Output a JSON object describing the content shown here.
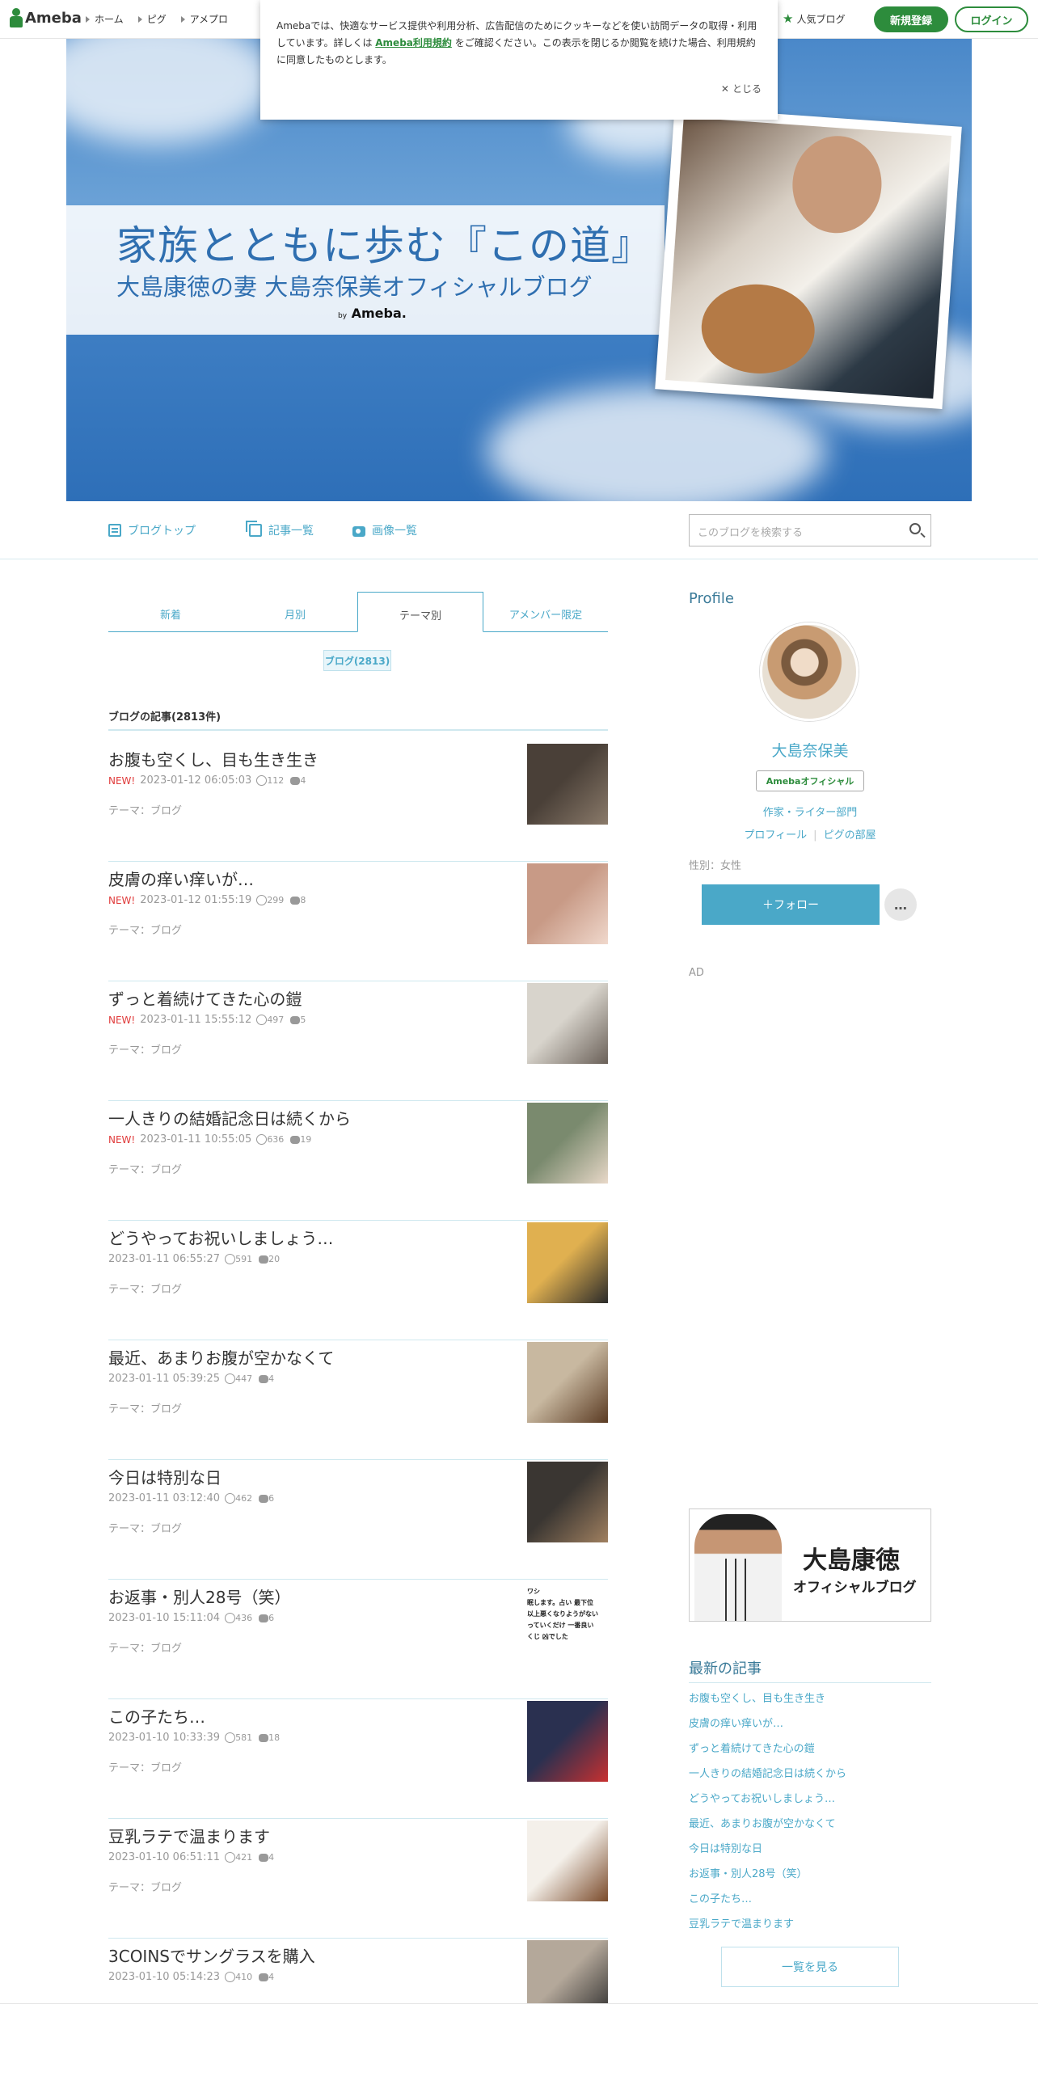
{
  "topbar": {
    "logo": "Ameba",
    "nav": [
      "ホーム",
      "ピグ",
      "アメプロ"
    ],
    "popular": "人気ブログ",
    "signup": "新規登録",
    "login": "ログイン"
  },
  "cookie": {
    "text_before": "Amebaでは、快適なサービス提供や利用分析、広告配信のためにクッキーなどを使い訪問データの取得・利用しています。詳しくは ",
    "link": "Ameba利用規約",
    "text_after": " をご確認ください。この表示を閉じるか閲覧を続けた場合、利用規約に同意したものとします。",
    "close": "とじる"
  },
  "banner": {
    "title": "家族とともに歩む『この道』",
    "subtitle": "大島康徳の妻 大島奈保美オフィシャルブログ",
    "by": "by",
    "brand": "Ameba."
  },
  "blognav": {
    "top": "ブログトップ",
    "list": "記事一覧",
    "images": "画像一覧",
    "search_placeholder": "このブログを検索する"
  },
  "tabs": [
    "新着",
    "月別",
    "テーマ別",
    "アメンバー限定"
  ],
  "theme_tag": "ブログ(2813)",
  "list_heading": "ブログの記事(2813件)",
  "posts": [
    {
      "title": "お腹も空くし、目も生き生き",
      "new": "NEW!",
      "date": "2023-01-12 06:05:03",
      "likes": "112",
      "comments": "4",
      "theme": "テーマ：ブログ"
    },
    {
      "title": "皮膚の痒い痒いが…",
      "new": "NEW!",
      "date": "2023-01-12 01:55:19",
      "likes": "299",
      "comments": "8",
      "theme": "テーマ：ブログ"
    },
    {
      "title": "ずっと着続けてきた心の鎧",
      "new": "NEW!",
      "date": "2023-01-11 15:55:12",
      "likes": "497",
      "comments": "5",
      "theme": "テーマ：ブログ"
    },
    {
      "title": "一人きりの結婚記念日は続くから",
      "new": "NEW!",
      "date": "2023-01-11 10:55:05",
      "likes": "636",
      "comments": "19",
      "theme": "テーマ：ブログ"
    },
    {
      "title": "どうやってお祝いしましょう…",
      "new": "",
      "date": "2023-01-11 06:55:27",
      "likes": "591",
      "comments": "20",
      "theme": "テーマ：ブログ"
    },
    {
      "title": "最近、あまりお腹が空かなくて",
      "new": "",
      "date": "2023-01-11 05:39:25",
      "likes": "447",
      "comments": "4",
      "theme": "テーマ：ブログ"
    },
    {
      "title": "今日は特別な日",
      "new": "",
      "date": "2023-01-11 03:12:40",
      "likes": "462",
      "comments": "6",
      "theme": "テーマ：ブログ"
    },
    {
      "title": "お返事・別人28号（笑）",
      "new": "",
      "date": "2023-01-10 15:11:04",
      "likes": "436",
      "comments": "6",
      "theme": "テーマ：ブログ"
    },
    {
      "title": "この子たち…",
      "new": "",
      "date": "2023-01-10 10:33:39",
      "likes": "581",
      "comments": "18",
      "theme": "テーマ：ブログ"
    },
    {
      "title": "豆乳ラテで温まります",
      "new": "",
      "date": "2023-01-10 06:51:11",
      "likes": "421",
      "comments": "4",
      "theme": "テーマ：ブログ"
    },
    {
      "title": "3COINSでサングラスを購入",
      "new": "",
      "date": "2023-01-10 05:14:23",
      "likes": "410",
      "comments": "4",
      "theme": ""
    }
  ],
  "thumb_colors": [
    [
      "#4a4038",
      "#8a7a6a"
    ],
    [
      "#c89a86",
      "#f0d8cc"
    ],
    [
      "#d8d4cc",
      "#6a6058"
    ],
    [
      "#7a8a6e",
      "#e8d8c8"
    ],
    [
      "#e0b050",
      "#2a2a2a"
    ],
    [
      "#c8b8a0",
      "#5a3a22"
    ],
    [
      "#3a3632",
      "#a08060"
    ],
    [
      "#ffffff",
      "#333333"
    ],
    [
      "#2a3050",
      "#c83030"
    ],
    [
      "#f4f0ea",
      "#7a4a2a"
    ],
    [
      "#b4a89a",
      "#2a2a2a"
    ]
  ],
  "thumb7_text": [
    "ワシ",
    "眠します。占い 最下位",
    "以上悪くなりようがない",
    "っていくだけ 一番良い",
    "くじ 凶でした"
  ],
  "sidebar": {
    "profile_heading": "Profile",
    "name": "大島奈保美",
    "badge": "Amebaオフィシャル",
    "category": "作家・ライター部門",
    "profile_link": "プロフィール",
    "pig_link": "ピグの部屋",
    "gender": "性別：女性",
    "follow": "＋フォロー",
    "more": "…",
    "ad": "AD",
    "banner_title": "大島康徳",
    "banner_subtitle": "オフィシャルブログ",
    "recent_heading": "最新の記事",
    "recent": [
      "お腹も空くし、目も生き生き",
      "皮膚の痒い痒いが…",
      "ずっと着続けてきた心の鎧",
      "一人きりの結婚記念日は続くから",
      "どうやってお祝いしましょう…",
      "最近、あまりお腹が空かなくて",
      "今日は特別な日",
      "お返事・別人28号（笑）",
      "この子たち…",
      "豆乳ラテで温まります"
    ],
    "see_more": "一覧を見る"
  },
  "colors": {
    "brand_green": "#2d8c3c",
    "accent_blue": "#4aa8c8",
    "new_red": "#e03b3b"
  }
}
